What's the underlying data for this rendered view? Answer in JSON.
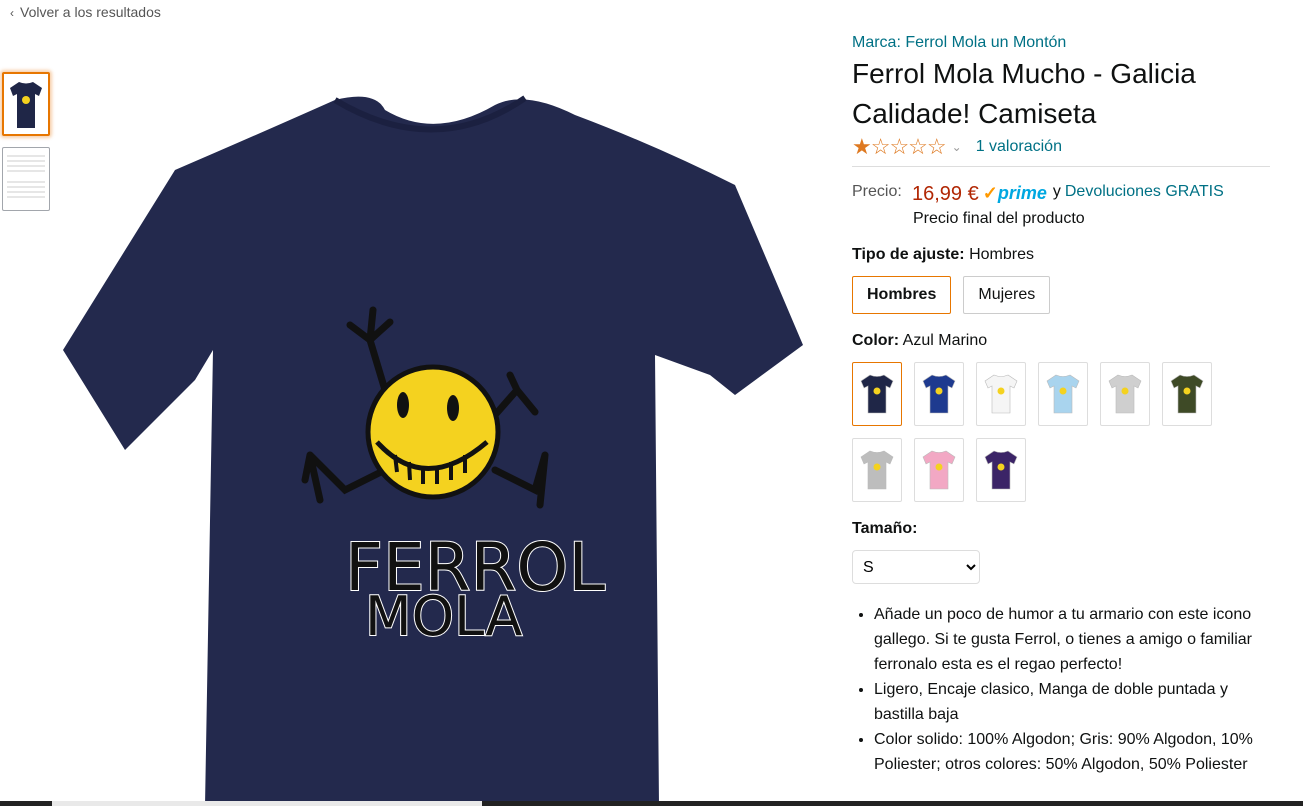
{
  "nav": {
    "back_label": "Volver a los resultados"
  },
  "product": {
    "brand": "Marca: Ferrol Mola un Montón",
    "title": "Ferrol Mola Mucho - Galicia Calidade! Camiseta",
    "rating_stars": 1,
    "rating_count": "1 valoración",
    "price_label": "Precio:",
    "price": "16,99 €",
    "prime": "prime",
    "and": "y",
    "returns": "Devoluciones GRATIS",
    "final_price_note": "Precio final del producto",
    "shirt_text_line1": "FERROL",
    "shirt_text_line2": "MOLA"
  },
  "fit": {
    "label": "Tipo de ajuste:",
    "value": "Hombres",
    "options": [
      "Hombres",
      "Mujeres"
    ]
  },
  "color": {
    "label": "Color:",
    "value": "Azul Marino",
    "swatch_colors": [
      "#1f2647",
      "#1e3a8f",
      "#f5f5f5",
      "#a9d4ee",
      "#cfcfcf",
      "#3e4a26",
      "#bdbdbd",
      "#f2a8c4",
      "#3b2467"
    ]
  },
  "size": {
    "label": "Tamaño:",
    "selected": "S"
  },
  "bullets": [
    "Añade un poco de humor a tu armario con este icono gallego. Si te gusta Ferrol, o tienes a amigo o familiar ferronalo esta es el regao perfecto!",
    "Ligero, Encaje clasico, Manga de doble puntada y bastilla baja",
    "Color solido: 100% Algodon; Gris: 90% Algodon, 10% Poliester; otros colores: 50% Algodon, 50% Poliester"
  ]
}
